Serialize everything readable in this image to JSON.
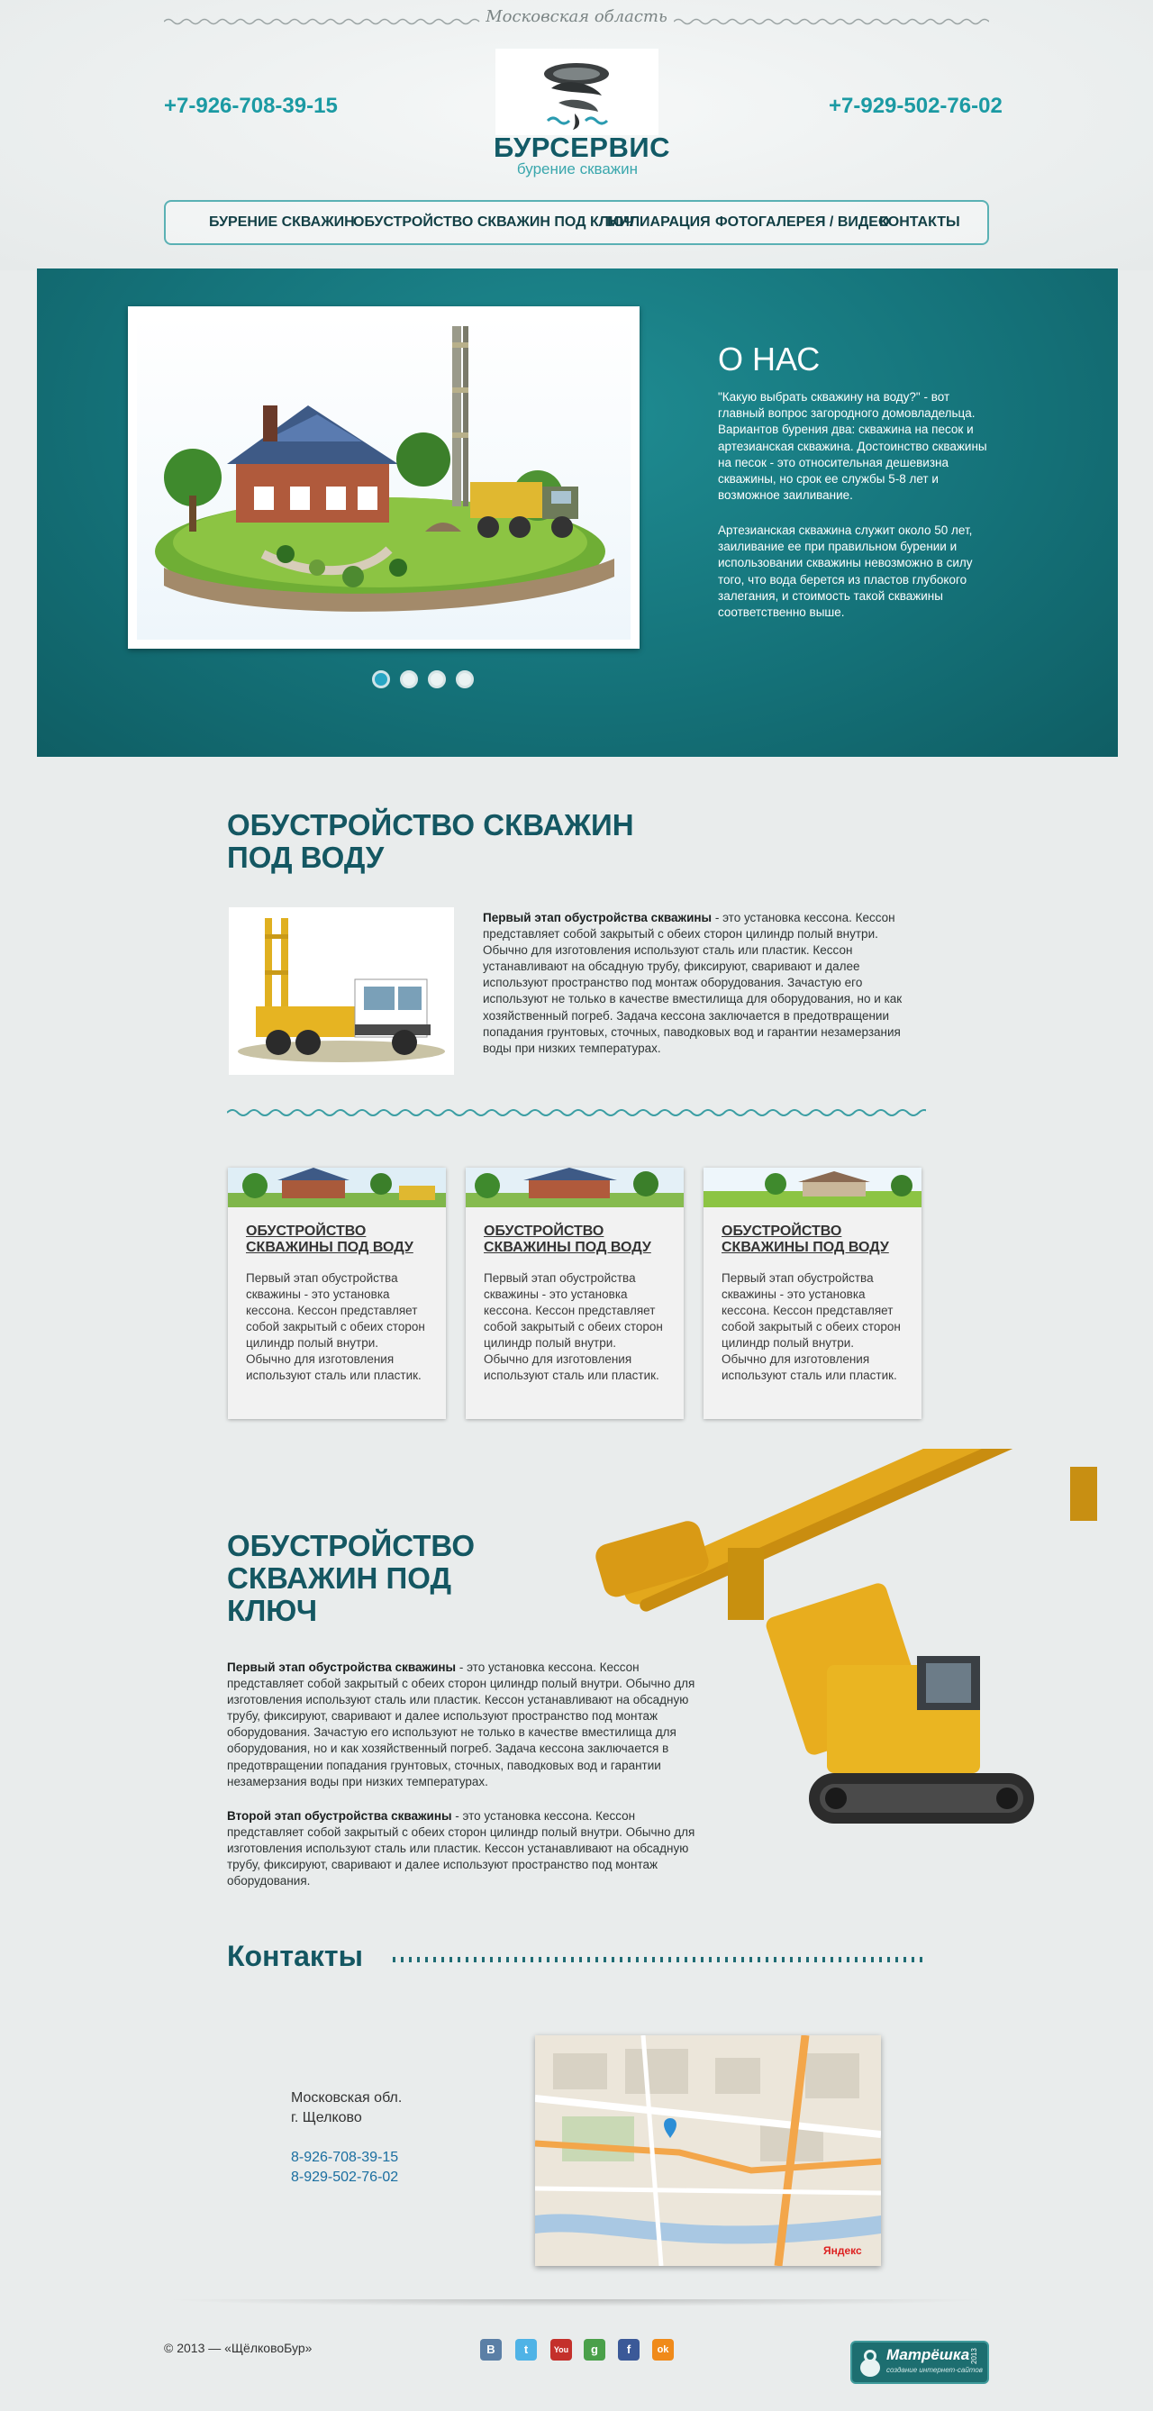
{
  "header": {
    "region": "Московская область",
    "phone_left": "+7-926-708-39-15",
    "phone_right": "+7-929-502-76-02",
    "logo_title": "БУРСЕРВИС",
    "logo_subtitle": "бурение скважин"
  },
  "nav": {
    "items": [
      {
        "label": "БУРЕНИЕ СКВАЖИН"
      },
      {
        "label": "ОБУСТРОЙСТВО СКВАЖИН ПОД КЛЮЧ"
      },
      {
        "label": "МИЛИАРАЦИЯ"
      },
      {
        "label": "ФОТОГАЛЕРЕЯ / ВИДЕО"
      },
      {
        "label": "КОНТАКТЫ"
      }
    ]
  },
  "hero": {
    "title": "О НАС",
    "paragraph1": "\"Какую выбрать скважину на воду?\" - вот главный вопрос загородного домовладельца. Вариантов бурения два: скважина на песок и артезианская скважина. Достоинство скважины на песок - это относительная дешевизна скважины, но срок ее службы 5-8 лет и возможное заиливание.",
    "paragraph2": "Артезианская скважина служит около 50 лет, заиливание ее при правильном бурении и использовании скважины невозможно в силу того, что вода берется из пластов глубокого залегания, и стоимость такой скважины соответственно выше.",
    "slide_count": 4,
    "active_slide": 1
  },
  "section1": {
    "title_line1": "ОБУСТРОЙСТВО СКВАЖИН",
    "title_line2": "ПОД ВОДУ",
    "lead_bold": "Первый этап обустройства скважины",
    "lead_text": " - это установка кессона. Кессон представляет собой закрытый с обеих сторон цилиндр полый внутри. Обычно для изготовления используют сталь или пластик. Кессон устанавливают на обсадную трубу, фиксируют, сваривают и далее используют пространство под монтаж оборудования. Зачастую его используют не только в качестве вместилища для оборудования, но и как хозяйственный погреб. Задача кессона заключается в предотвращении попадания грунтовых, сточных, паводковых вод и гарантии незамерзания воды при низких температурах."
  },
  "cards": [
    {
      "title": "ОБУСТРОЙСТВО СКВАЖИНЫ ПОД ВОДУ",
      "text": "Первый этап обустройства скважины - это установка кессона. Кессон представляет собой закрытый с обеих сторон цилиндр полый внутри. Обычно для изготовления используют сталь или пластик."
    },
    {
      "title": "ОБУСТРОЙСТВО СКВАЖИНЫ ПОД ВОДУ",
      "text": "Первый этап обустройства скважины - это установка кессона. Кессон представляет собой закрытый с обеих сторон цилиндр полый внутри. Обычно для изготовления используют сталь или пластик."
    },
    {
      "title": "ОБУСТРОЙСТВО СКВАЖИНЫ ПОД ВОДУ",
      "text": "Первый этап обустройства скважины - это установка кессона. Кессон представляет собой закрытый с обеих сторон цилиндр полый внутри. Обычно для изготовления используют сталь или пластик."
    }
  ],
  "section2": {
    "title_line1": "ОБУСТРОЙСТВО",
    "title_line2": "СКВАЖИН ПОД",
    "title_line3": "КЛЮЧ",
    "p1_bold": "Первый этап обустройства скважины",
    "p1_text": " - это установка кессона. Кессон представляет собой закрытый с обеих сторон цилиндр полый внутри. Обычно для изготовления используют сталь или пластик. Кессон устанавливают на обсадную трубу, фиксируют, сваривают и далее используют пространство под монтаж оборудования. Зачастую его используют не только в качестве вместилища для оборудования, но и как хозяйственный погреб. Задача кессона заключается в предотвращении попадания грунтовых, сточных, паводковых вод и гарантии незамерзания воды при низких температурах.",
    "p2_bold": "Второй этап обустройства скважины",
    "p2_text": " - это установка кессона. Кессон представляет собой закрытый с обеих сторон цилиндр полый внутри. Обычно для изготовления используют сталь или пластик. Кессон устанавливают на обсадную трубу, фиксируют, сваривают и далее используют пространство под монтаж оборудования."
  },
  "contacts": {
    "title": "Контакты",
    "address_line1": "Московская обл.",
    "address_line2": "г. Щелково",
    "phone1": "8-926-708-39-15",
    "phone2": "8-929-502-76-02",
    "map_brand": "Яндекс"
  },
  "footer": {
    "copyright": "© 2013 — «ЩёлковоБур»",
    "social": [
      {
        "icon": "vk-icon",
        "glyph": "В",
        "color": "#5b7fa6"
      },
      {
        "icon": "twitter-icon",
        "glyph": "t",
        "color": "#4fb3e6"
      },
      {
        "icon": "youtube-icon",
        "glyph": "You",
        "color": "#c4302b"
      },
      {
        "icon": "google-icon",
        "glyph": "g",
        "color": "#4aa04a"
      },
      {
        "icon": "facebook-icon",
        "glyph": "f",
        "color": "#3b5998"
      },
      {
        "icon": "odnoklassniki-icon",
        "glyph": "ok",
        "color": "#f08a1a"
      }
    ],
    "badge_title": "Матрёшка",
    "badge_sub": "создание интернет-сайтов",
    "badge_year": "2013"
  }
}
